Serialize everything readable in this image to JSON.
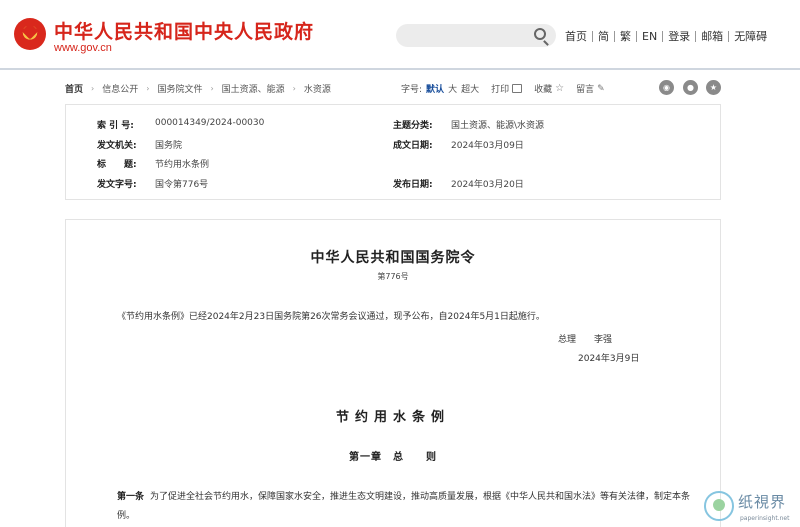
{
  "header": {
    "site_title": "中华人民共和国中央人民政府",
    "site_domain": "www.gov.cn",
    "search_placeholder": "",
    "links": [
      "首页",
      "简",
      "繁",
      "EN",
      "登录",
      "邮箱",
      "无障碍"
    ]
  },
  "breadcrumb": [
    "首页",
    "信息公开",
    "国务院文件",
    "国土资源、能源",
    "水资源"
  ],
  "toolbar": {
    "font_label": "字号:",
    "font_sizes": [
      "默认",
      "大",
      "超大"
    ],
    "active_font_size": "默认",
    "print_label": "打印",
    "favorite_label": "收藏",
    "comment_label": "留言",
    "share_icons": [
      "weibo-icon",
      "wechat-icon",
      "favorite-star-icon"
    ]
  },
  "meta": {
    "index_label": "索 引 号:",
    "index_value": "000014349/2024-00030",
    "topic_label": "主题分类:",
    "topic_value": "国土资源、能源\\水资源",
    "issuer_label": "发文机关:",
    "issuer_value": "国务院",
    "created_label": "成文日期:",
    "created_value": "2024年03月09日",
    "title_label": "标　　题:",
    "title_value": "节约用水条例",
    "docno_label": "发文字号:",
    "docno_value": "国令第776号",
    "published_label": "发布日期:",
    "published_value": "2024年03月20日"
  },
  "article": {
    "order_title": "中华人民共和国国务院令",
    "order_no": "第776号",
    "intro": "《节约用水条例》已经2024年2月23日国务院第26次常务会议通过，现予公布，自2024年5月1日起施行。",
    "signer": "总理　　李强",
    "sign_date": "2024年3月9日",
    "regulation_title": "节约用水条例",
    "chapter": "第一章　总　　则",
    "article1_label": "第一条",
    "article1_text": "为了促进全社会节约用水，保障国家水安全，推进生态文明建设，推动高质量发展，根据《中华人民共和国水法》等有关法律，制定本条例。"
  },
  "watermark": {
    "name": "纸視界",
    "url": "paperinsight.net"
  },
  "colors": {
    "brand_red": "#d6251b",
    "active_blue": "#1a4f9c"
  }
}
